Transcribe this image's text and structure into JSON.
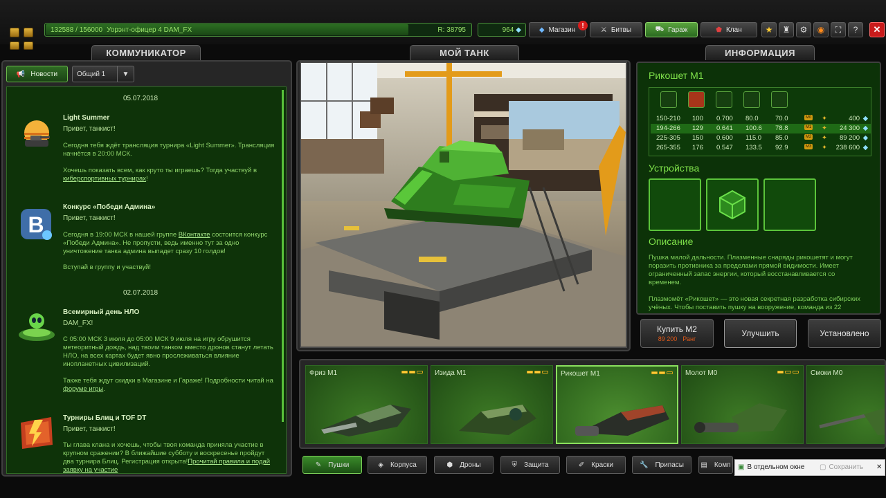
{
  "top": {
    "xp": "132588 / 156000",
    "xp_progress": 0.85,
    "rank_name": "Уорэнт-офицер 4 DAM_FX",
    "rating": "R: 38795",
    "crystals": "964",
    "shop_label": "Магазин",
    "shop_badge": "!",
    "battles_label": "Битвы",
    "garage_label": "Гараж",
    "clan_label": "Клан",
    "close_label": "✕"
  },
  "panels": {
    "communicator_title": "КОММУНИКАТОР",
    "tank_title": "МОЙ ТАНК",
    "info_title": "ИНФОРМАЦИЯ"
  },
  "communicator": {
    "news_tab": "Новости",
    "channel": "Общий 1",
    "date1": "05.07.2018",
    "date2": "02.07.2018",
    "items": [
      {
        "title": "Light Summer",
        "subtitle": "Привет, танкист!",
        "p1": "Сегодня тебя ждёт трансляция турнира «Light Summer». Трансляция начнётся в 20:00 МСК.",
        "p2": "Хочешь показать всем, как круто ты играешь? Тогда участвуй в",
        "link": "киберспортивных турнирах",
        "p2_end": "!"
      },
      {
        "title": "Конкурс «Победи Админа»",
        "subtitle": "Привет, танкист!",
        "p1_a": "Сегодня в 19:00 МСК в нашей группе",
        "link": "ВКонтакте",
        "p1_b": "состоится конкурс «Победи Админа». Не пропусти, ведь именно тут за одно уничтожение танка админа выпадет сразу 10 голдов!",
        "p2": "Вступай в группу и участвуй!"
      },
      {
        "title": "Всемирный день НЛО",
        "subtitle": "DAM_FX!",
        "p1": "С 05:00 МСК 3 июля до 05:00 МСК 9 июля на игру обрушится метеоритный дождь, над твоим танком вместо дронов станут летать НЛО, на всех картах будет явно прослеживаться влияние инопланетных цивилизаций.",
        "p2_a": "Также тебя ждут скидки в Магазине и Гараже! Подробности читай на",
        "link": "форуме игры",
        "p2_end": "."
      },
      {
        "title": "Турниры Блиц и TOF DT",
        "subtitle": "Привет, танкист!",
        "p1_a": "Ты глава клана и хочешь, чтобы твоя команда приняла участие в крупном сражении? В ближайшие субботу и воскресенье пройдут два турнира Блиц. Регистрация открыта!",
        "link": "Прочитай правила и подай заявку на участие"
      }
    ]
  },
  "info": {
    "item_title": "Рикошет М1",
    "rows": [
      {
        "range": "150-210",
        "a": "100",
        "b": "0.700",
        "c": "80.0",
        "d": "70.0",
        "tag": "M0",
        "price": "400"
      },
      {
        "range": "194-266",
        "a": "129",
        "b": "0.641",
        "c": "100.6",
        "d": "78.8",
        "tag": "M1",
        "price": "24 300"
      },
      {
        "range": "225-305",
        "a": "150",
        "b": "0.600",
        "c": "115.0",
        "d": "85.0",
        "tag": "M2",
        "price": "89 200"
      },
      {
        "range": "265-355",
        "a": "176",
        "b": "0.547",
        "c": "133.5",
        "d": "92.9",
        "tag": "M3",
        "price": "238 600"
      }
    ],
    "devices_title": "Устройства",
    "desc_title": "Описание",
    "desc_p1": "Пушка малой дальности. Плазменные снаряды рикошетят и могут поразить противника за пределами прямой видимости. Имеет ограниченный запас энергии, который восстанавливается со временем.",
    "desc_p2": "Плазмомёт «Рикошет» — это новая секретная разработка сибирских учёных. Чтобы поставить пушку на вооружение, команда из 22"
  },
  "actions": {
    "buy_label": "Купить М2",
    "buy_price": "89 200",
    "buy_rank": "Ранг",
    "upgrade_label": "Улучшить",
    "installed_label": "Установлено"
  },
  "items": [
    {
      "name": "Фриз М1",
      "level": 1
    },
    {
      "name": "Изида М1",
      "level": 1
    },
    {
      "name": "Рикошет М1",
      "level": 1
    },
    {
      "name": "Молот М0",
      "level": 0
    },
    {
      "name": "Смоки М0",
      "level": 0
    }
  ],
  "categories": [
    "Пушки",
    "Корпуса",
    "Дроны",
    "Защита",
    "Краски",
    "Припасы",
    "Комп"
  ],
  "popup": {
    "open_label": "В отдельном окне",
    "save_label": "Сохранить"
  }
}
